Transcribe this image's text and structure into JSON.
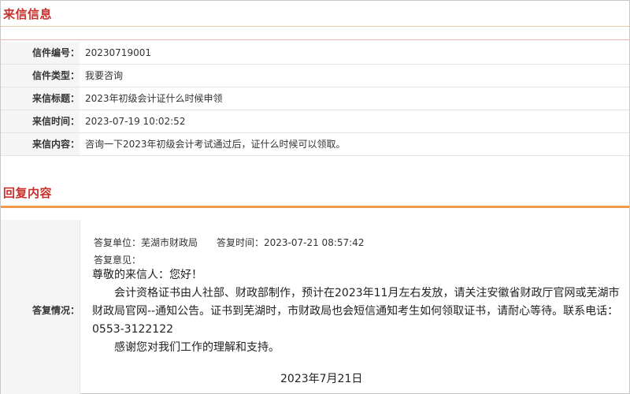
{
  "letter_section": {
    "title": "来信信息",
    "rows": [
      {
        "label": "信件编号：",
        "value": "20230719001"
      },
      {
        "label": "信件类型：",
        "value": "我要咨询"
      },
      {
        "label": "来信标题：",
        "value": "2023年初级会计证什么时候申领"
      },
      {
        "label": "来信时间：",
        "value": "2023-07-19 10:02:52"
      },
      {
        "label": "来信内容：",
        "value": "咨询一下2023年初级会计考试通过后，证什么时候可以领取。"
      }
    ]
  },
  "reply_section": {
    "title": "回复内容",
    "label": "答复情况：",
    "unit_line": "答复单位：芜湖市财政局　　答复时间：2023-07-21 08:57:42",
    "opinion_label": "答复意见：",
    "greeting": "尊敬的来信人：您好！",
    "paragraph1": "会计资格证书由人社部、财政部制作，预计在2023年11月左右发放，请关注安徽省财政厅官网或芜湖市财政局官网--通知公告。证书到芜湖时，市财政局也会短信通知考生如何领取证书，请耐心等待。联系电话：0553-3122122",
    "paragraph2": "感谢您对我们工作的理解和支持。",
    "date": "2023年7月21日"
  }
}
